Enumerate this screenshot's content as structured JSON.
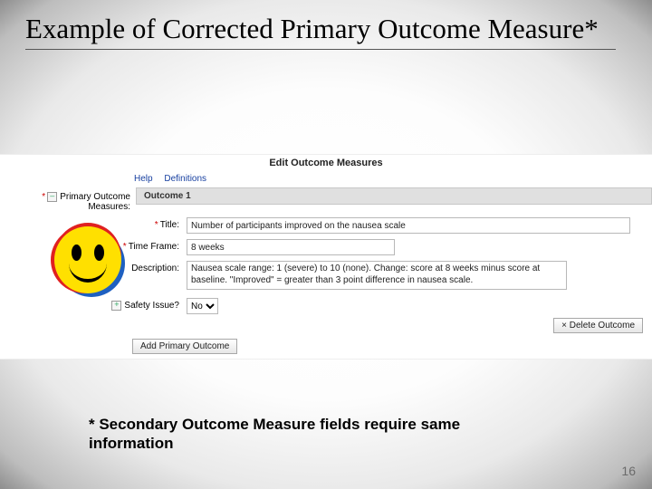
{
  "slide": {
    "title": "Example of Corrected Primary Outcome Measure*",
    "footnote": "* Secondary Outcome Measure fields require same information",
    "page_number": "16"
  },
  "app": {
    "heading": "Edit Outcome Measures",
    "help_link": "Help",
    "definitions_link": "Definitions",
    "section_label": "Primary Outcome Measures:",
    "required_mark": "*",
    "outcome_header": "Outcome 1",
    "fields": {
      "title_label": "Title:",
      "title_value": "Number of participants improved on the nausea scale",
      "time_label": "Time Frame:",
      "time_value": "8 weeks",
      "desc_label": "Description:",
      "desc_value": "Nausea scale range: 1 (severe) to 10 (none). Change: score at 8 weeks minus score at baseline. \"Improved\" = greater than 3 point difference in nausea scale.",
      "safety_label": "Safety Issue?",
      "safety_value": "No"
    },
    "delete_btn": "× Delete Outcome",
    "add_btn": "Add Primary Outcome"
  }
}
